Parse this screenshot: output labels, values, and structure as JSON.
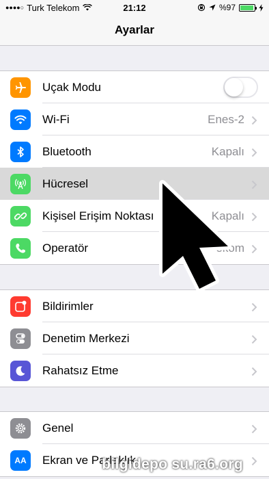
{
  "status_bar": {
    "carrier": "Turk Telekom",
    "time": "21:12",
    "battery_percent": "%97",
    "battery_level": 0.97
  },
  "nav": {
    "title": "Ayarlar"
  },
  "groups": [
    {
      "items": [
        {
          "label": "Uçak Modu",
          "icon": "airplane-icon",
          "color": "#ff9500",
          "control": "toggle",
          "toggle_on": false
        },
        {
          "label": "Wi-Fi",
          "icon": "wifi-icon",
          "color": "#007aff",
          "value": "Enes-2"
        },
        {
          "label": "Bluetooth",
          "icon": "bluetooth-icon",
          "color": "#007aff",
          "value": "Kapalı"
        },
        {
          "label": "Hücresel",
          "icon": "cellular-antenna-icon",
          "color": "#4cd964",
          "value": ""
        },
        {
          "label": "Kişisel Erişim Noktası",
          "icon": "hotspot-icon",
          "color": "#4cd964",
          "value": "Kapalı"
        },
        {
          "label": "Operatör",
          "icon": "phone-icon",
          "color": "#4cd964",
          "value": "ekom"
        }
      ]
    },
    {
      "items": [
        {
          "label": "Bildirimler",
          "icon": "notifications-icon",
          "color": "#ff3b30"
        },
        {
          "label": "Denetim Merkezi",
          "icon": "control-center-icon",
          "color": "#8e8e93"
        },
        {
          "label": "Rahatsız Etme",
          "icon": "moon-icon",
          "color": "#5856d6"
        }
      ]
    },
    {
      "items": [
        {
          "label": "Genel",
          "icon": "gear-icon",
          "color": "#8e8e93"
        },
        {
          "label": "Ekran ve Parlaklık",
          "icon": "display-brightness-icon",
          "color": "#007aff"
        }
      ]
    }
  ],
  "watermark": "bilgidepos u.ra6.org",
  "watermark_text": "bilgidepo su.ra6.org",
  "watermark_display": "bilgidepo su.ra6.org"
}
